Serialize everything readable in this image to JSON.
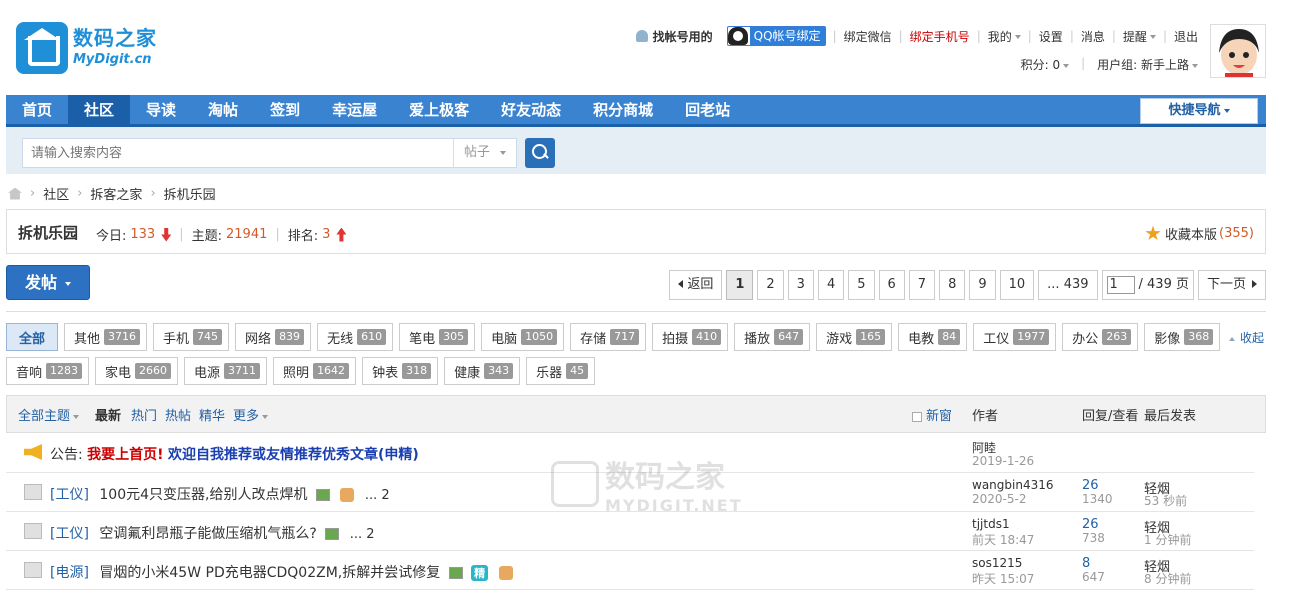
{
  "header": {
    "logo_cn": "数码之家",
    "logo_en": "MyDigit.cn",
    "find_account": "找帐号用的",
    "qq_bind": "QQ帐号绑定",
    "bind_wechat": "绑定微信",
    "bind_phone": "绑定手机号",
    "mine": "我的",
    "settings": "设置",
    "messages": "消息",
    "remind": "提醒",
    "logout": "退出",
    "points": "积分: 0",
    "usergroup": "用户组: 新手上路"
  },
  "nav": {
    "items": [
      {
        "label": "首页"
      },
      {
        "label": "社区"
      },
      {
        "label": "导读"
      },
      {
        "label": "淘帖"
      },
      {
        "label": "签到"
      },
      {
        "label": "幸运屋"
      },
      {
        "label": "爱上极客"
      },
      {
        "label": "好友动态"
      },
      {
        "label": "积分商城"
      },
      {
        "label": "回老站"
      }
    ],
    "active_index": 1,
    "quick_nav": "快捷导航"
  },
  "search": {
    "placeholder": "请输入搜索内容",
    "type": "帖子"
  },
  "breadcrumb": [
    "社区",
    "拆客之家",
    "拆机乐园"
  ],
  "forum": {
    "name": "拆机乐园",
    "today_label": "今日:",
    "today": "133",
    "topics_label": "主题:",
    "topics": "21941",
    "rank_label": "排名:",
    "rank": "3",
    "favorite_label": "收藏本版",
    "favorite_count": "(355)"
  },
  "post_button": "发帖",
  "pager": {
    "back": "返回",
    "pages": [
      "1",
      "2",
      "3",
      "4",
      "5",
      "6",
      "7",
      "8",
      "9",
      "10"
    ],
    "last": "... 439",
    "input_value": "1",
    "total": "/ 439 页",
    "next": "下一页"
  },
  "tags": [
    {
      "label": "全部",
      "count": ""
    },
    {
      "label": "其他",
      "count": "3716"
    },
    {
      "label": "手机",
      "count": "745"
    },
    {
      "label": "网络",
      "count": "839"
    },
    {
      "label": "无线",
      "count": "610"
    },
    {
      "label": "笔电",
      "count": "305"
    },
    {
      "label": "电脑",
      "count": "1050"
    },
    {
      "label": "存储",
      "count": "717"
    },
    {
      "label": "拍摄",
      "count": "410"
    },
    {
      "label": "播放",
      "count": "647"
    },
    {
      "label": "游戏",
      "count": "165"
    },
    {
      "label": "电教",
      "count": "84"
    },
    {
      "label": "工仪",
      "count": "1977"
    },
    {
      "label": "办公",
      "count": "263"
    },
    {
      "label": "影像",
      "count": "368"
    },
    {
      "label": "音响",
      "count": "1283"
    },
    {
      "label": "家电",
      "count": "2660"
    },
    {
      "label": "电源",
      "count": "3711"
    },
    {
      "label": "照明",
      "count": "1642"
    },
    {
      "label": "钟表",
      "count": "318"
    },
    {
      "label": "健康",
      "count": "343"
    },
    {
      "label": "乐器",
      "count": "45"
    }
  ],
  "collapse": "收起",
  "list_header": {
    "all": "全部主题",
    "newest": "最新",
    "hot": "热门",
    "hotpost": "热帖",
    "digest": "精华",
    "more": "更多",
    "newwin": "新窗",
    "author": "作者",
    "reply_view": "回复/查看",
    "last_post": "最后发表"
  },
  "announcement": {
    "prefix": "公告:",
    "red": "我要上首页!",
    "blue": "欢迎自我推荐或友情推荐优秀文章(申精)",
    "author": "阿睦",
    "date": "2019-1-26"
  },
  "threads": [
    {
      "cat": "[工仪]",
      "title": "100元4只变压器,给别人改点焊机",
      "pages": "... 2",
      "author": "wangbin4316",
      "date": "2020-5-2",
      "replies": "26",
      "views": "1340",
      "last": "轻烟",
      "last_time": "53 秒前"
    },
    {
      "cat": "[工仪]",
      "title": "空调氟利昂瓶子能做压缩机气瓶么?",
      "pages": "... 2",
      "author": "tjjtds1",
      "date": "前天 18:47",
      "replies": "26",
      "views": "738",
      "last": "轻烟",
      "last_time": "1 分钟前"
    },
    {
      "cat": "[电源]",
      "title": "冒烟的小米45W PD充电器CDQ02ZM,拆解并尝试修复",
      "pages": "",
      "author": "sos1215",
      "date": "昨天 15:07",
      "replies": "8",
      "views": "647",
      "last": "轻烟",
      "last_time": "8 分钟前"
    }
  ],
  "watermark": {
    "cn": "数码之家",
    "en": "MYDIGIT.NET"
  },
  "colors": {
    "nav": "#3a83d1",
    "nav_active": "#1a5fa8",
    "accent": "#2361a6",
    "number": "#d35a28",
    "red": "#cc0000"
  }
}
